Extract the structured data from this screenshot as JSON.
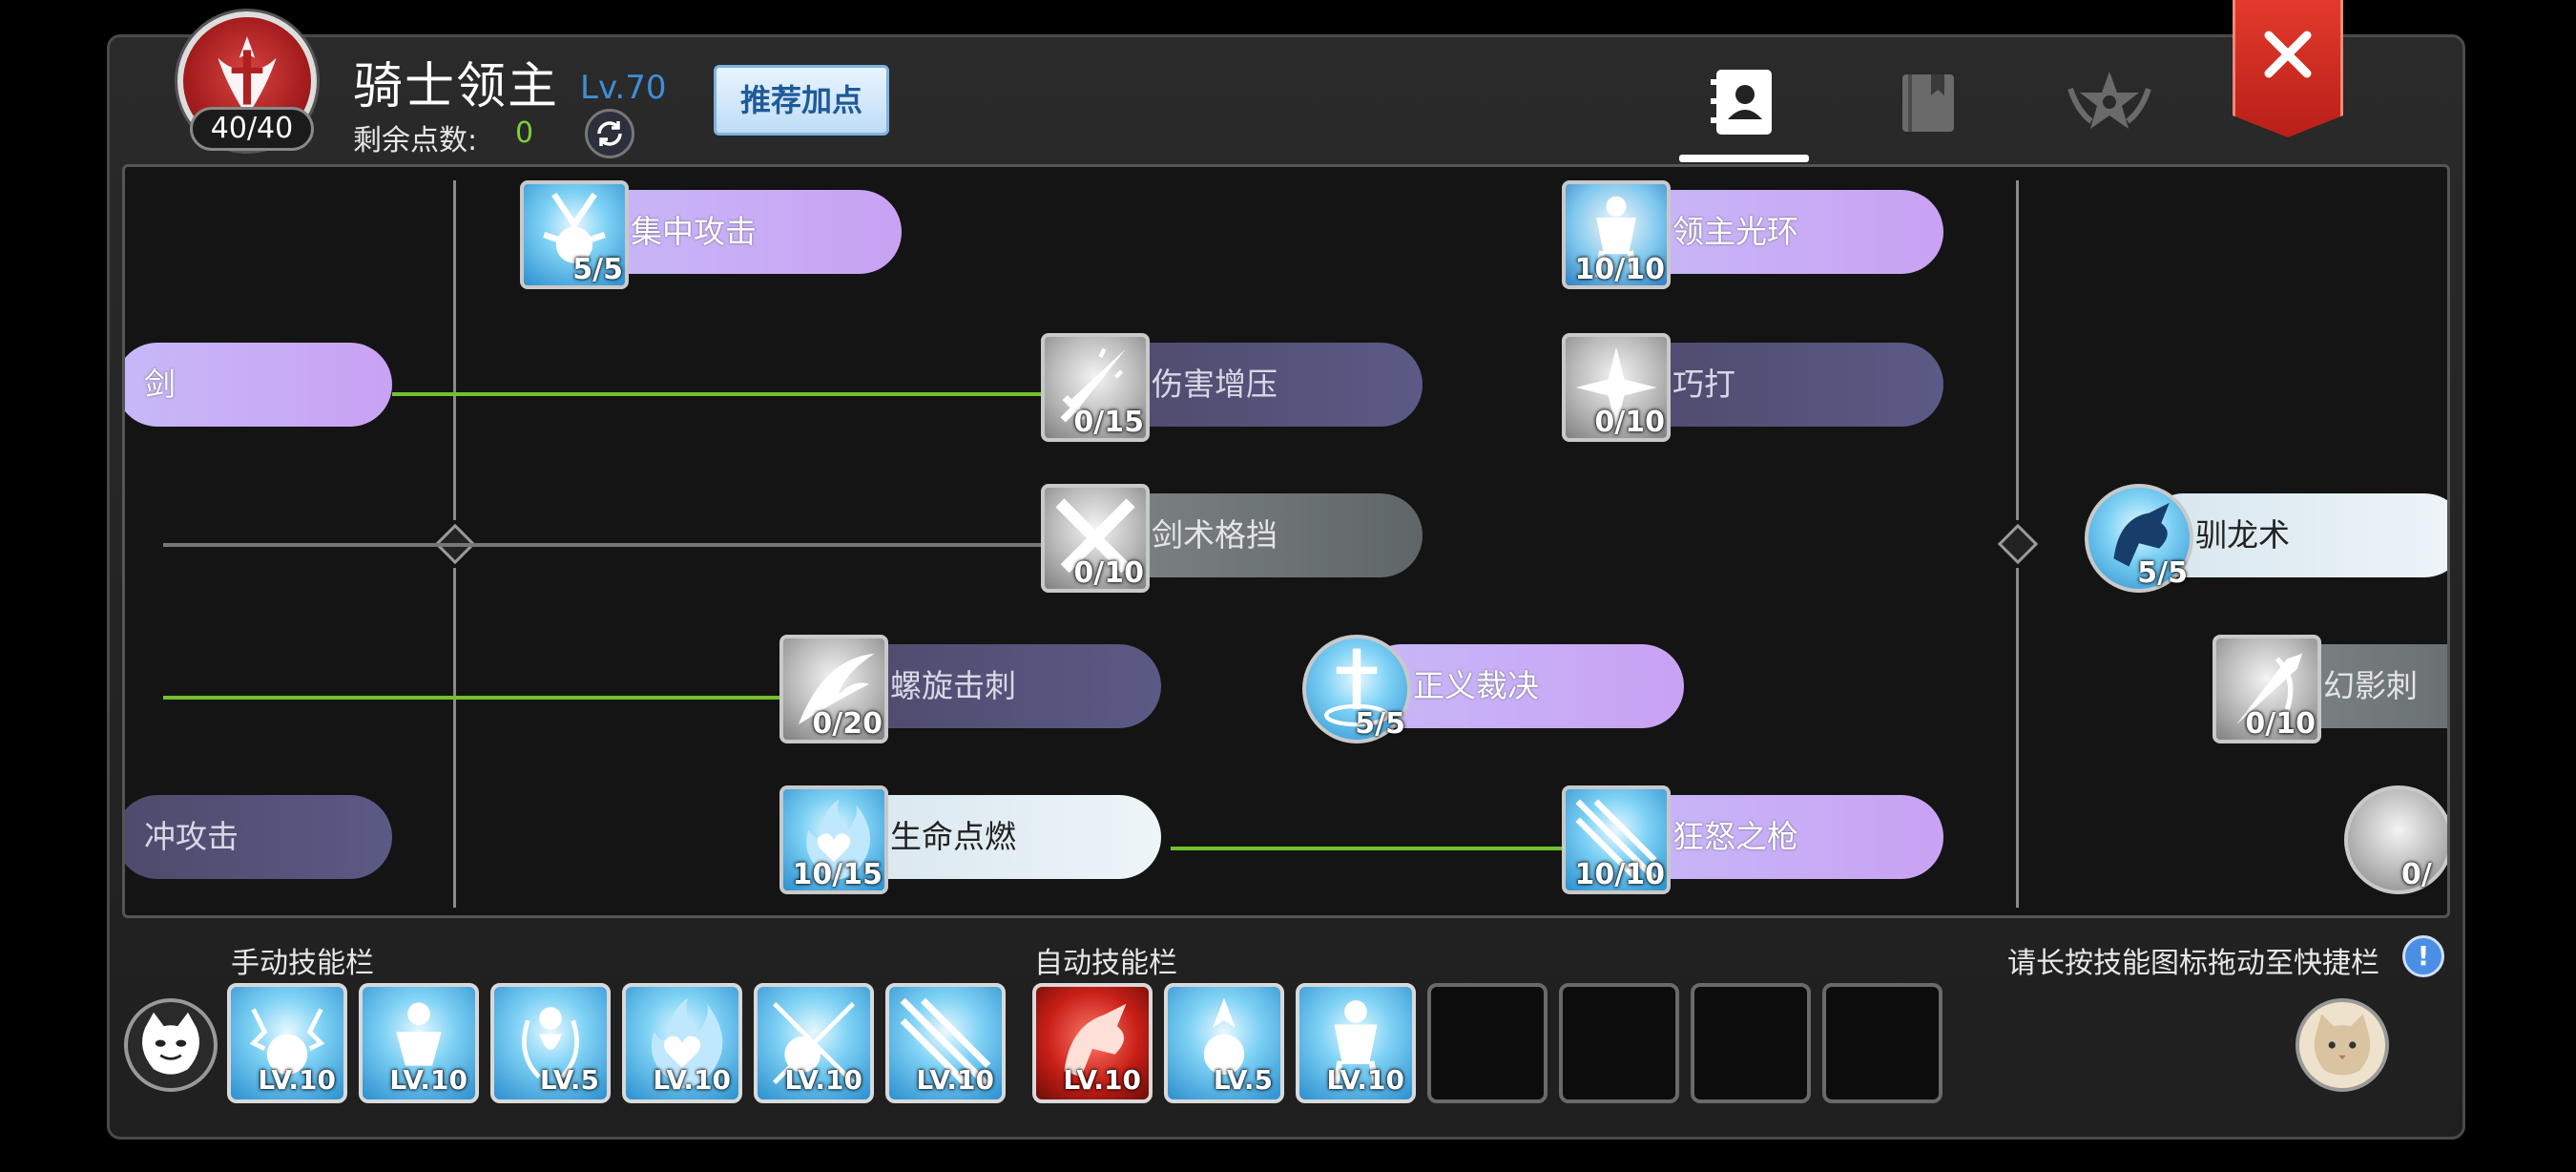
{
  "header": {
    "emblem_count": "40/40",
    "title": "骑士领主",
    "level": "Lv.70",
    "points_label": "剩余点数:",
    "points_value": "0",
    "recommend_label": "推荐加点"
  },
  "tabs": [
    {
      "name": "skill-book-tab",
      "icon": "contact-book-icon",
      "active": true
    },
    {
      "name": "book-tab",
      "icon": "book-icon",
      "active": false
    },
    {
      "name": "emblem-tab",
      "icon": "star-emblem-icon",
      "active": false
    }
  ],
  "skills": [
    {
      "label": "集中攻击",
      "count": "5/5",
      "style": "purple",
      "icon": "focus-attack-icon"
    },
    {
      "label": "领主光环",
      "count": "10/10",
      "style": "purple",
      "icon": "lord-aura-icon"
    },
    {
      "label": "剑",
      "count": "",
      "style": "purple",
      "icon": ""
    },
    {
      "label": "伤害增压",
      "count": "0/15",
      "style": "dim",
      "icon": "sword-boost-icon"
    },
    {
      "label": "巧打",
      "count": "0/10",
      "style": "dim",
      "icon": "skillful-strike-icon"
    },
    {
      "label": "剑术格挡",
      "count": "0/10",
      "style": "grey",
      "icon": "sword-parry-icon"
    },
    {
      "label": "驯龙术",
      "count": "5/5",
      "style": "pale",
      "icon": "dragon-tame-icon"
    },
    {
      "label": "螺旋击刺",
      "count": "0/20",
      "style": "dim",
      "icon": "spiral-thrust-icon"
    },
    {
      "label": "正义裁决",
      "count": "5/5",
      "style": "purple",
      "icon": "justice-icon"
    },
    {
      "label": "幻影刺",
      "count": "0/10",
      "style": "grey",
      "icon": "phantom-stab-icon"
    },
    {
      "label": "冲攻击",
      "count": "",
      "style": "dim",
      "icon": ""
    },
    {
      "label": "生命点燃",
      "count": "10/15",
      "style": "pale",
      "icon": "life-ignite-icon"
    },
    {
      "label": "狂怒之枪",
      "count": "10/10",
      "style": "purple",
      "icon": "fury-spear-icon"
    },
    {
      "label": "",
      "count": "0/",
      "style": "",
      "icon": "partial-skill-icon"
    }
  ],
  "bottom": {
    "manual_label": "手动技能栏",
    "auto_label": "自动技能栏",
    "hint": "请长按技能图标拖动至快捷栏",
    "hint_icon": "!",
    "manual_slots": [
      "LV.10",
      "LV.10",
      "LV.5",
      "LV.10",
      "LV.10",
      "LV.10"
    ],
    "auto_slots": [
      "LV.10",
      "LV.5",
      "LV.10"
    ]
  },
  "colors": {
    "accent_blue": "#3d8ed8",
    "points_green": "#7bd03c",
    "connector_green": "#71c22b",
    "close_red": "#d62b22"
  }
}
